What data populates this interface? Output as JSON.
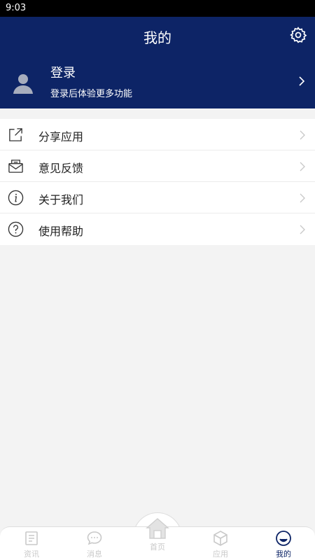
{
  "status_bar": {
    "time": "9:03"
  },
  "header": {
    "title": "我的"
  },
  "profile": {
    "title": "登录",
    "subtitle": "登录后体验更多功能"
  },
  "menu": {
    "items": [
      {
        "label": "分享应用",
        "icon": "share-icon"
      },
      {
        "label": "意见反馈",
        "icon": "feedback-icon"
      },
      {
        "label": "关于我们",
        "icon": "info-icon"
      },
      {
        "label": "使用帮助",
        "icon": "help-icon"
      }
    ]
  },
  "tabbar": {
    "items": [
      {
        "label": "资讯",
        "icon": "news-icon"
      },
      {
        "label": "消息",
        "icon": "message-icon"
      },
      {
        "label": "首页",
        "icon": "home-icon"
      },
      {
        "label": "应用",
        "icon": "apps-icon"
      },
      {
        "label": "我的",
        "icon": "profile-icon"
      }
    ],
    "active_index": 4
  },
  "colors": {
    "header_bg": "#0d2466",
    "page_bg": "#f3f3f3",
    "tab_inactive": "#c9c9c9",
    "tab_active": "#0d2466"
  }
}
